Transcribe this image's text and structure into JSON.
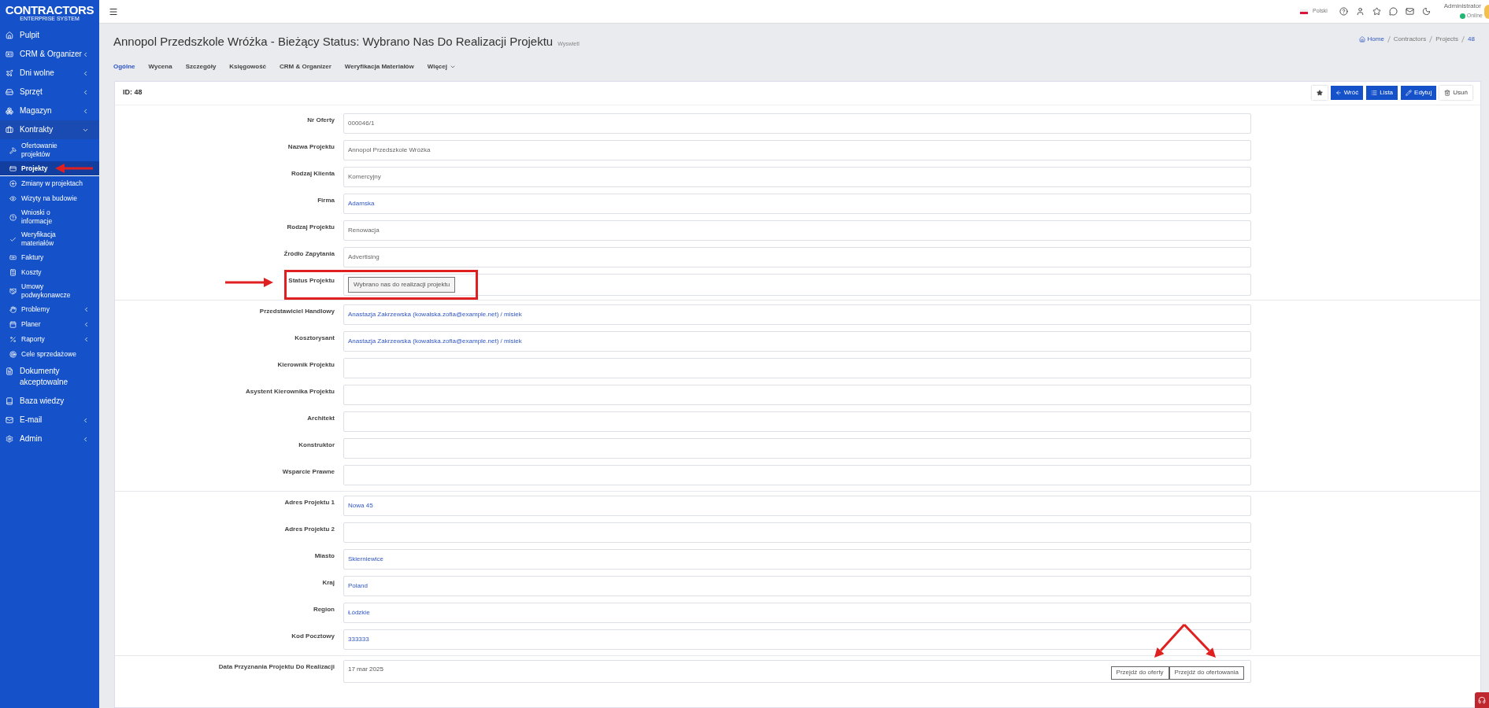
{
  "brand": {
    "name": "CONTRACTORS",
    "tagline": "ENTERPRISE SYSTEM"
  },
  "sidebar": {
    "items": [
      {
        "label": "Pulpit",
        "kind": "link"
      },
      {
        "label": "CRM & Organizer",
        "kind": "menu",
        "expanded": false
      },
      {
        "label": "Dni wolne",
        "kind": "menu",
        "expanded": false
      },
      {
        "label": "Sprzęt",
        "kind": "menu",
        "expanded": false
      },
      {
        "label": "Magazyn",
        "kind": "menu",
        "expanded": false
      },
      {
        "label": "Kontrakty",
        "kind": "menu",
        "expanded": true,
        "children": [
          {
            "label": "Ofertowanie projektów",
            "kind": "link",
            "selected": false
          },
          {
            "label": "Projekty",
            "kind": "link",
            "selected": true
          },
          {
            "label": "Zmiany w projektach",
            "kind": "link",
            "selected": false
          },
          {
            "label": "Wizyty na budowie",
            "kind": "link",
            "selected": false
          },
          {
            "label": "Wnioski o informacje",
            "kind": "link",
            "selected": false
          },
          {
            "label": "Weryfikacja materiałów",
            "kind": "link",
            "selected": false
          },
          {
            "label": "Faktury",
            "kind": "link",
            "selected": false
          },
          {
            "label": "Koszty",
            "kind": "link",
            "selected": false
          },
          {
            "label": "Umowy podwykonawcze",
            "kind": "link",
            "selected": false
          },
          {
            "label": "Problemy",
            "kind": "menu",
            "selected": false
          },
          {
            "label": "Planer",
            "kind": "menu",
            "selected": false
          },
          {
            "label": "Raporty",
            "kind": "menu",
            "selected": false
          },
          {
            "label": "Cele sprzedażowe",
            "kind": "link",
            "selected": false
          }
        ]
      },
      {
        "label": "Dokumenty akceptowalne",
        "kind": "link"
      },
      {
        "label": "Baza wiedzy",
        "kind": "link"
      },
      {
        "label": "E-mail",
        "kind": "menu",
        "expanded": false
      },
      {
        "label": "Admin",
        "kind": "menu",
        "expanded": false
      }
    ]
  },
  "topbar": {
    "language": "Polski",
    "user": {
      "name": "Administrator",
      "status": "Online"
    }
  },
  "header": {
    "title": "Annopol Przedszkole Wróżka - Bieżący Status: Wybrano Nas Do Realizacji Projektu",
    "subtitle": "Wyswietl",
    "breadcrumb": [
      "Home",
      "Contractors",
      "Projects",
      "48"
    ]
  },
  "tabs": [
    {
      "label": "Ogólne",
      "selected": true
    },
    {
      "label": "Wycena",
      "selected": false
    },
    {
      "label": "Szczegóły",
      "selected": false
    },
    {
      "label": "Księgowość",
      "selected": false
    },
    {
      "label": "CRM & Organizer",
      "selected": false
    },
    {
      "label": "Weryfikacja Materiałów",
      "selected": false
    },
    {
      "label": "Więcej",
      "selected": false,
      "dropdown": true
    }
  ],
  "card": {
    "title": "ID: 48",
    "buttons": [
      {
        "kind": "star"
      },
      {
        "kind": "primary",
        "label": "Wróć"
      },
      {
        "kind": "primary",
        "label": "Lista"
      },
      {
        "kind": "primary",
        "label": "Edytuj"
      },
      {
        "kind": "secondary",
        "label": "Usuń"
      }
    ]
  },
  "sections": [
    {
      "fields": [
        {
          "label": "Nr Oferty",
          "kind": "text",
          "value": "000046/1"
        },
        {
          "label": "Nazwa Projektu",
          "kind": "text",
          "value": "Annopol Przedszkole Wróżka"
        },
        {
          "label": "Rodzaj Klienta",
          "kind": "text",
          "value": "Komercyjny"
        },
        {
          "label": "Firma",
          "kind": "link",
          "value": "Adamska"
        },
        {
          "label": "Rodzaj Projektu",
          "kind": "text",
          "value": "Renowacja"
        },
        {
          "label": "Źródło Zapytania",
          "kind": "text",
          "value": "Advertising"
        },
        {
          "label": "Status Projektu",
          "kind": "badge",
          "value": "Wybrano nas do realizacji projektu"
        }
      ]
    },
    {
      "fields": [
        {
          "label": "Przedstawiciel Handlowy",
          "kind": "link",
          "value": "Anastazja Zakrzewska (kowalska.zofia@example.net) / misiek"
        },
        {
          "label": "Kosztorysant",
          "kind": "link",
          "value": "Anastazja Zakrzewska (kowalska.zofia@example.net) / misiek"
        },
        {
          "label": "Kierownik Projektu",
          "kind": "text"
        },
        {
          "label": "Asystent Kierownika Projektu",
          "kind": "text"
        },
        {
          "label": "Architekt",
          "kind": "text"
        },
        {
          "label": "Konstruktor",
          "kind": "text"
        },
        {
          "label": "Wsparcie Prawne",
          "kind": "text"
        }
      ]
    },
    {
      "fields": [
        {
          "label": "Adres Projektu 1",
          "kind": "link",
          "value": "Nowa 45"
        },
        {
          "label": "Adres Projektu 2",
          "kind": "text"
        },
        {
          "label": "Miasto",
          "kind": "link",
          "value": "Skierniewice"
        },
        {
          "label": "Kraj",
          "kind": "link",
          "value": "Poland"
        },
        {
          "label": "Region",
          "kind": "link",
          "value": "Łódzkie"
        },
        {
          "label": "Kod Pocztowy",
          "kind": "link",
          "value": "333333"
        }
      ]
    },
    {
      "fields": [
        {
          "label": "Data Przyznania Projektu Do Realizacji",
          "kind": "date_actions",
          "value": "17 mar 2025",
          "actions": [
            "Przejdź do oferty",
            "Przejdź do ofertowania"
          ]
        }
      ]
    }
  ]
}
